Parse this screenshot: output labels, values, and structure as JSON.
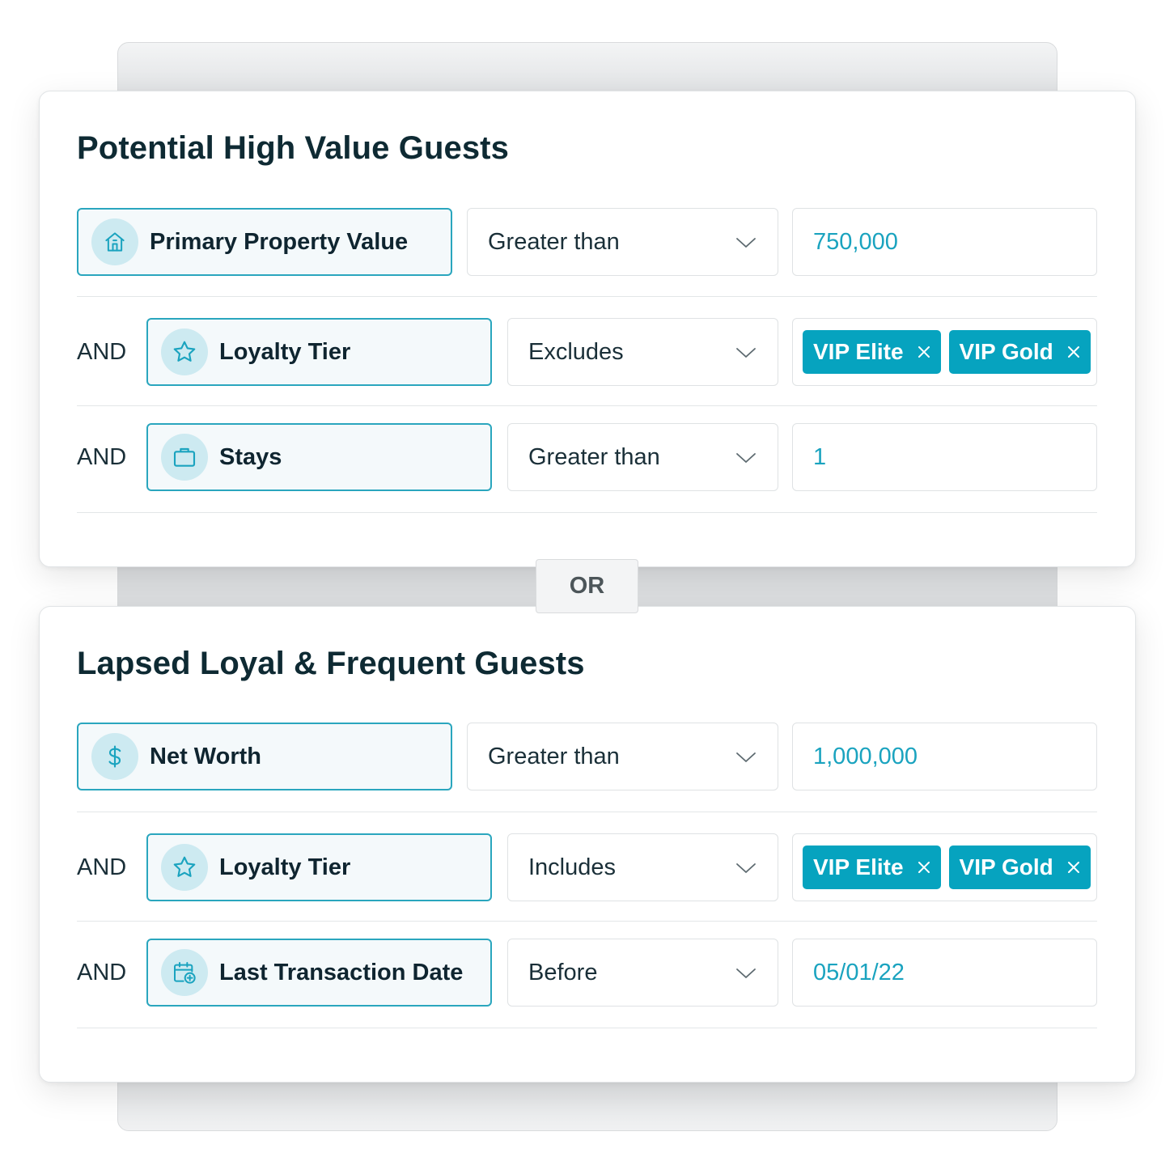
{
  "or_label": "OR",
  "colors": {
    "accent": "#06a3bf",
    "field_border": "#2aa6be",
    "field_bg": "#f4f9fb",
    "icon_bg": "#cdeaf1",
    "value_text": "#1aa3bf"
  },
  "segments": [
    {
      "title": "Potential High Value Guests",
      "rules": [
        {
          "connector": "",
          "field_icon": "home-icon",
          "field_label": "Primary Property Value",
          "operator": "Greater than",
          "value": "750,000"
        },
        {
          "connector": "AND",
          "field_icon": "star-icon",
          "field_label": "Loyalty Tier",
          "operator": "Excludes",
          "chips": [
            "VIP Elite",
            "VIP Gold"
          ]
        },
        {
          "connector": "AND",
          "field_icon": "briefcase-icon",
          "field_label": "Stays",
          "operator": "Greater than",
          "value": "1"
        }
      ]
    },
    {
      "title": "Lapsed Loyal & Frequent Guests",
      "rules": [
        {
          "connector": "",
          "field_icon": "dollar-icon",
          "field_label": "Net Worth",
          "operator": "Greater than",
          "value": "1,000,000"
        },
        {
          "connector": "AND",
          "field_icon": "star-icon",
          "field_label": "Loyalty Tier",
          "operator": "Includes",
          "chips": [
            "VIP Elite",
            "VIP Gold"
          ]
        },
        {
          "connector": "AND",
          "field_icon": "calendar-add-icon",
          "field_label": "Last Transaction Date",
          "operator": "Before",
          "value": "05/01/22"
        }
      ]
    }
  ]
}
